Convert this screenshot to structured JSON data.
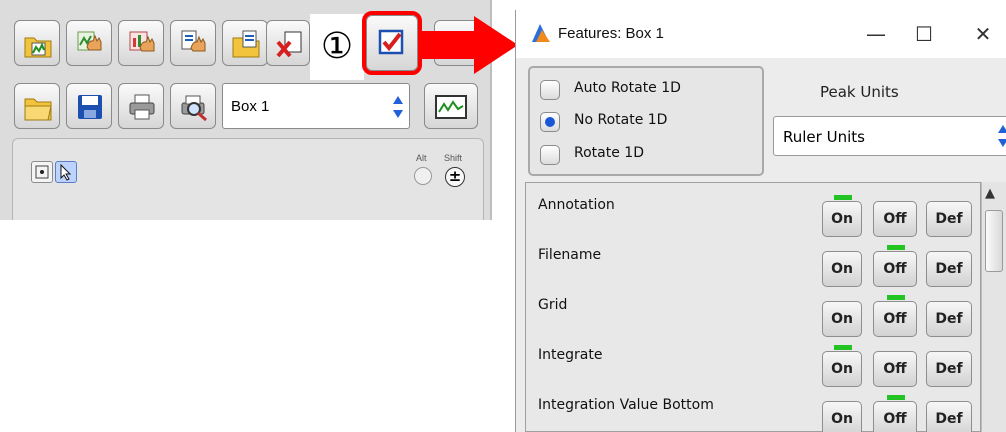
{
  "toolbar": {
    "row1_icons": [
      "open-spectrum-icon",
      "hand-pan-icon",
      "hand-multi-icon",
      "hand-copy-icon",
      "open-folder-doc-icon",
      "close-spectrum-icon",
      "features-checkbox-icon",
      "partial-button"
    ],
    "row2_icons": [
      "open-folder-icon",
      "save-disk-icon",
      "print-icon",
      "print-preview-icon"
    ],
    "box_select_value": "Box 1",
    "alt_label": "Alt",
    "shift_label": "Shift",
    "shift_symbol": "±"
  },
  "callout": {
    "step_number": "①",
    "highlight_color": "#ff0000"
  },
  "features_window": {
    "title": "Features: Box 1",
    "controls": {
      "minimize": "—",
      "maximize": "☐",
      "close": "✕"
    },
    "rotate_options": [
      {
        "label": "Auto Rotate 1D",
        "checked": false
      },
      {
        "label": "No Rotate 1D",
        "checked": true
      },
      {
        "label": "Rotate 1D",
        "checked": false
      }
    ],
    "peak_units_label": "Peak Units",
    "peak_units_value": "Ruler Units",
    "toggle_labels": {
      "on": "On",
      "off": "Off",
      "def": "Def"
    },
    "features": [
      {
        "name": "Annotation",
        "state": "on"
      },
      {
        "name": "Filename",
        "state": "off"
      },
      {
        "name": "Grid",
        "state": "off"
      },
      {
        "name": "Integrate",
        "state": "on"
      },
      {
        "name": "Integration Value Bottom",
        "state": "off"
      }
    ],
    "led_color": "#22c322"
  }
}
